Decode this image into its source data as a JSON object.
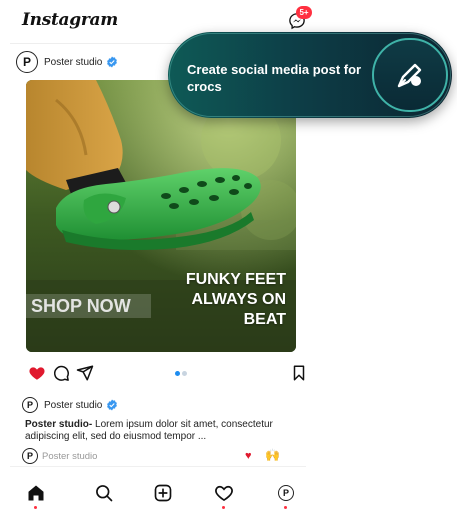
{
  "header": {
    "logo_text": "Instagram",
    "messages_badge": "5+"
  },
  "post": {
    "author": "Poster studio",
    "avatar_letter": "P",
    "headline_lines": [
      "FUNKY FEET",
      "ALWAYS ON",
      "BEAT"
    ],
    "cta_label": "SHOP NOW",
    "carousel_dots": 2,
    "carousel_active": 1
  },
  "details": {
    "author": "Poster studio",
    "avatar_letter": "P",
    "caption_author": "Poster studio-",
    "caption_text": " Lorem ipsum dolor sit amet, consectetur adipiscing elit, sed do eiusmod tempor ...",
    "comment_placeholder": "Poster studio",
    "reaction_heart": "♥",
    "reaction_hands": "🙌"
  },
  "prompt": {
    "text": "Create social media post for crocs"
  },
  "colors": {
    "like_red": "#e0192e",
    "verified_blue": "#3897f0",
    "badge_red": "#ff3040",
    "croc_green": "#3cb043",
    "card_teal": "#0e5a56",
    "card_navy": "#0c2531"
  },
  "icons": {
    "messenger": "messenger-icon",
    "verified": "verified-badge-icon",
    "like": "heart-filled-icon",
    "comment": "comment-bubble-icon",
    "share": "paper-plane-icon",
    "save": "bookmark-icon",
    "home": "home-icon",
    "search": "search-icon",
    "create": "plus-square-icon",
    "activity": "heart-outline-icon",
    "profile": "profile-avatar-icon",
    "ai_pen": "pen-sparkle-icon"
  }
}
